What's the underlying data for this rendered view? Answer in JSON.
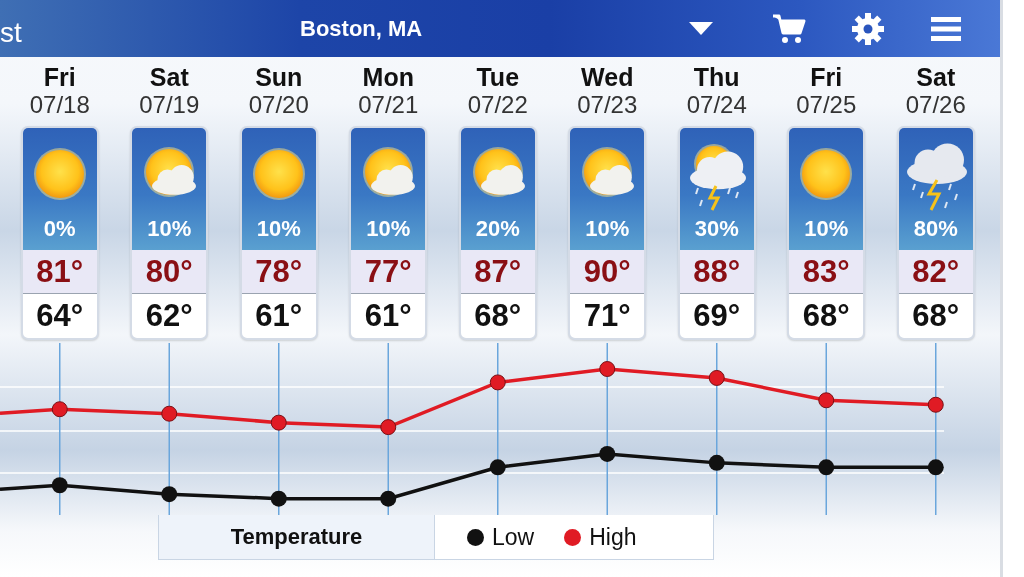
{
  "header": {
    "title_fragment": "st",
    "title": "Boston, MA"
  },
  "days": [
    {
      "day": "Fri",
      "date": "07/18",
      "kind": "sun",
      "precip": "0%",
      "high": "81°",
      "low": "64°"
    },
    {
      "day": "Sat",
      "date": "07/19",
      "kind": "partly-cloudy",
      "precip": "10%",
      "high": "80°",
      "low": "62°"
    },
    {
      "day": "Sun",
      "date": "07/20",
      "kind": "sun",
      "precip": "10%",
      "high": "78°",
      "low": "61°"
    },
    {
      "day": "Mon",
      "date": "07/21",
      "kind": "partly-cloudy",
      "precip": "10%",
      "high": "77°",
      "low": "61°"
    },
    {
      "day": "Tue",
      "date": "07/22",
      "kind": "partly-cloudy",
      "precip": "20%",
      "high": "87°",
      "low": "68°"
    },
    {
      "day": "Wed",
      "date": "07/23",
      "kind": "partly-cloudy",
      "precip": "10%",
      "high": "90°",
      "low": "71°"
    },
    {
      "day": "Thu",
      "date": "07/24",
      "kind": "thunder",
      "precip": "30%",
      "high": "88°",
      "low": "69°"
    },
    {
      "day": "Fri",
      "date": "07/25",
      "kind": "sun",
      "precip": "10%",
      "high": "83°",
      "low": "68°"
    },
    {
      "day": "Sat",
      "date": "07/26",
      "kind": "storm",
      "precip": "80%",
      "high": "82°",
      "low": "68°"
    }
  ],
  "legend": {
    "title": "Temperature",
    "items": [
      {
        "label": "Low",
        "color": "#111111"
      },
      {
        "label": "High",
        "color": "#e01b24"
      }
    ]
  }
}
